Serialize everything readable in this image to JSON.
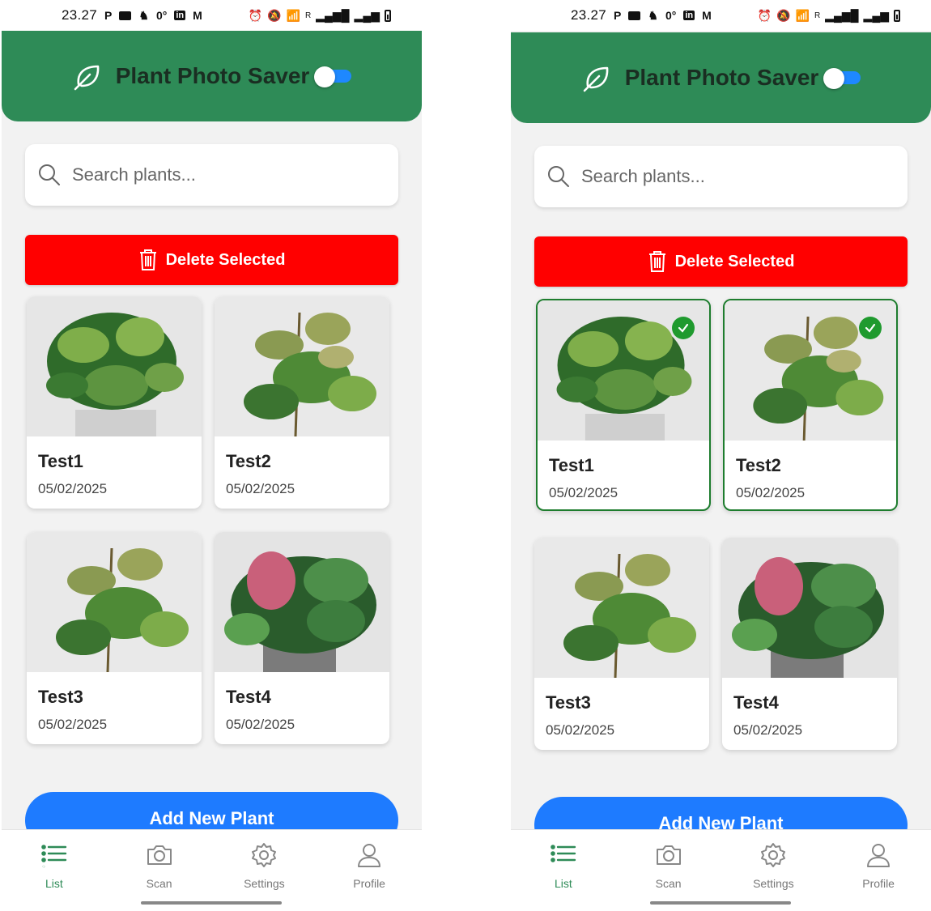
{
  "status": {
    "time": "23.27",
    "p_glyph": "P",
    "temp": "0°",
    "linkedin": "in",
    "mail": "M",
    "network": "R"
  },
  "app": {
    "title": "Plant Photo Saver",
    "toggle_state": "on",
    "brand_color": "#2e8b57"
  },
  "search": {
    "placeholder": "Search plants..."
  },
  "actions": {
    "delete_label": "Delete Selected",
    "add_label": "Add New Plant",
    "delete_color": "#ff0000",
    "add_color": "#1e7bff"
  },
  "nav": {
    "items": [
      {
        "label": "List",
        "icon": "list-icon",
        "active": true
      },
      {
        "label": "Scan",
        "icon": "camera-icon",
        "active": false
      },
      {
        "label": "Settings",
        "icon": "gear-icon",
        "active": false
      },
      {
        "label": "Profile",
        "icon": "user-icon",
        "active": false
      }
    ]
  },
  "screens": [
    {
      "plants": [
        {
          "name": "Test1",
          "date": "05/02/2025",
          "selected": false
        },
        {
          "name": "Test2",
          "date": "05/02/2025",
          "selected": false
        },
        {
          "name": "Test3",
          "date": "05/02/2025",
          "selected": false
        },
        {
          "name": "Test4",
          "date": "05/02/2025",
          "selected": false
        }
      ]
    },
    {
      "plants": [
        {
          "name": "Test1",
          "date": "05/02/2025",
          "selected": true
        },
        {
          "name": "Test2",
          "date": "05/02/2025",
          "selected": true
        },
        {
          "name": "Test3",
          "date": "05/02/2025",
          "selected": false
        },
        {
          "name": "Test4",
          "date": "05/02/2025",
          "selected": false
        }
      ]
    }
  ]
}
